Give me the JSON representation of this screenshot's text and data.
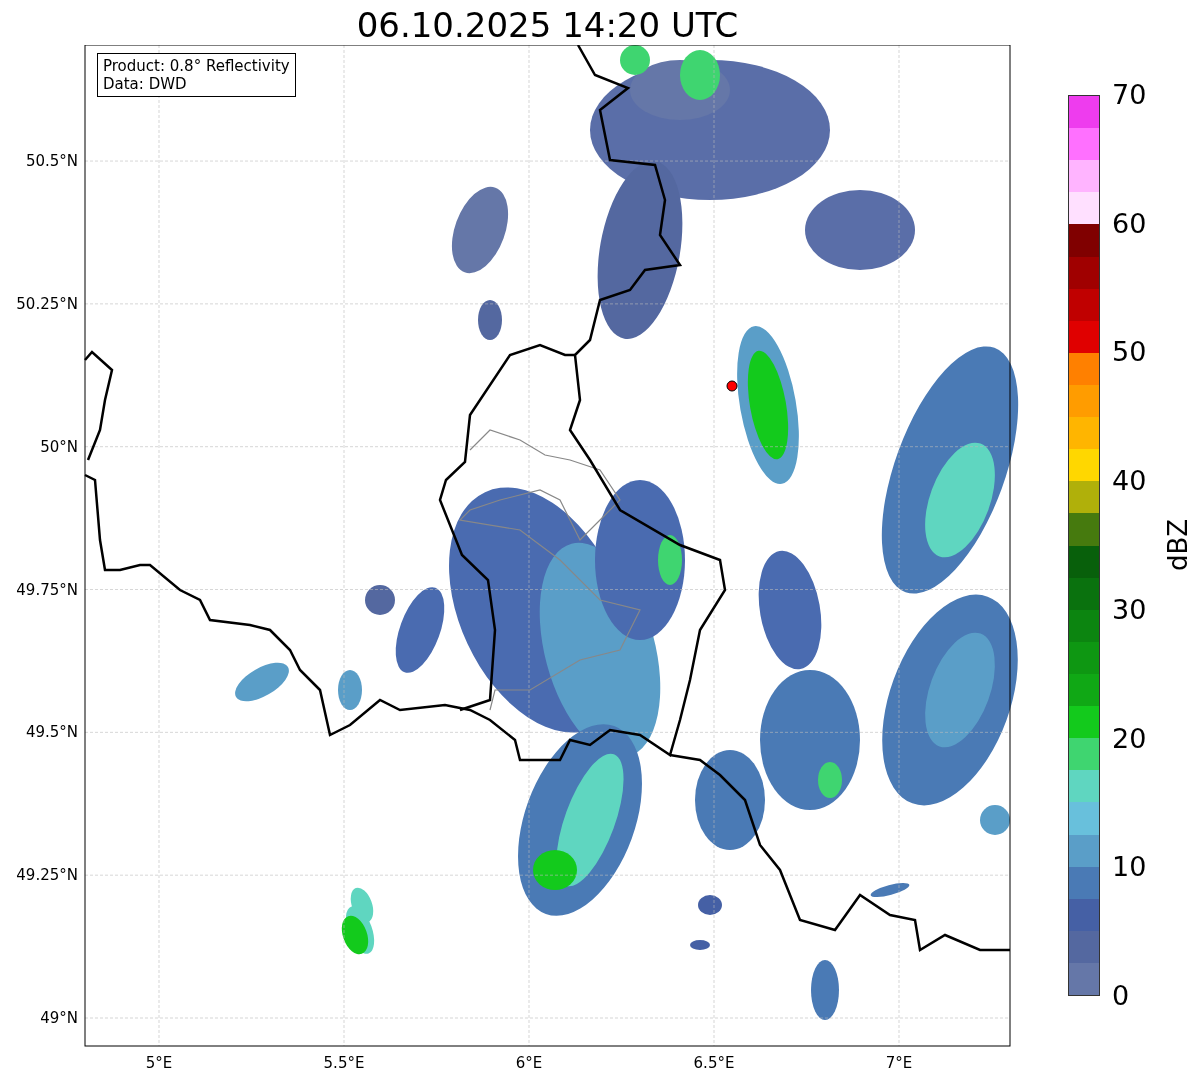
{
  "title": "06.10.2025 14:20 UTC",
  "legend": [
    "Product: 0.8° Reflectivity",
    "Data: DWD"
  ],
  "lat_ticks": [
    "50.5°N",
    "50.25°N",
    "50°N",
    "49.75°N",
    "49.5°N",
    "49.25°N",
    "49°N"
  ],
  "lon_ticks": [
    "5°E",
    "5.5°E",
    "6°E",
    "6.5°E",
    "7°E"
  ],
  "colorbar": {
    "label": "dBZ",
    "ticks": [
      "70",
      "60",
      "50",
      "40",
      "30",
      "20",
      "10",
      "0"
    ],
    "segments": [
      {
        "color": "#ee3cee"
      },
      {
        "color": "#ff70ff"
      },
      {
        "color": "#ffb4ff"
      },
      {
        "color": "#ffe0ff"
      },
      {
        "color": "#800000"
      },
      {
        "color": "#a00000"
      },
      {
        "color": "#c00000"
      },
      {
        "color": "#e00000"
      },
      {
        "color": "#ff8000"
      },
      {
        "color": "#ff9c00"
      },
      {
        "color": "#ffb500"
      },
      {
        "color": "#ffd700"
      },
      {
        "color": "#b0b00a"
      },
      {
        "color": "#467a0e"
      },
      {
        "color": "#08600b"
      },
      {
        "color": "#0a720e"
      },
      {
        "color": "#0c8510"
      },
      {
        "color": "#0e9712"
      },
      {
        "color": "#10a815"
      },
      {
        "color": "#13ca1c"
      },
      {
        "color": "#3fd570"
      },
      {
        "color": "#5fd6c0"
      },
      {
        "color": "#68c0dc"
      },
      {
        "color": "#5a9ec8"
      },
      {
        "color": "#4a7ab5"
      },
      {
        "color": "#4560a5"
      },
      {
        "color": "#5468a0"
      },
      {
        "color": "#6577a8"
      }
    ]
  }
}
